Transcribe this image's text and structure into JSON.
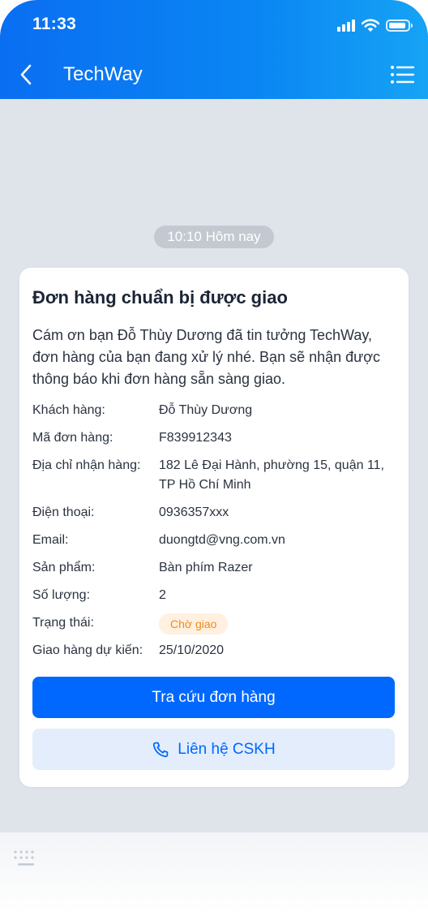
{
  "status_bar": {
    "time": "11:33",
    "icons": [
      "signal-icon",
      "wifi-icon",
      "battery-icon"
    ]
  },
  "header": {
    "title": "TechWay",
    "back_icon": "chevron-left-icon",
    "menu_icon": "list-menu-icon"
  },
  "chat": {
    "timestamp": "10:10 Hôm nay"
  },
  "order_card": {
    "title": "Đơn hàng chuẩn bị được giao",
    "message": "Cám ơn bạn Đỗ Thùy Dương đã tin tưởng TechWay, đơn hàng của bạn đang xử lý nhé. Bạn sẽ nhận được thông báo khi đơn hàng sẵn sàng giao.",
    "fields": [
      {
        "label": "Khách hàng:",
        "value": "Đỗ Thùy Dương"
      },
      {
        "label": "Mã đơn hàng:",
        "value": "F839912343"
      },
      {
        "label": "Địa chỉ nhận hàng:",
        "value": "182 Lê Đại Hành, phường 15, quận 11, TP Hồ Chí Minh"
      },
      {
        "label": "Điện thoại:",
        "value": "0936357xxx"
      },
      {
        "label": "Email:",
        "value": "duongtd@vng.com.vn"
      },
      {
        "label": "Sản phẩm:",
        "value": "Bàn phím Razer"
      },
      {
        "label": "Số lượng:",
        "value": "2"
      },
      {
        "label": "Trạng thái:",
        "value": "Chờ giao"
      },
      {
        "label": "Giao hàng dự kiến:",
        "value": "25/10/2020"
      }
    ],
    "primary_button": "Tra cứu đơn hàng",
    "secondary_button": "Liên hệ CSKH",
    "status_badge_color": "#f08a1c"
  },
  "colors": {
    "brand": "#0068ff",
    "header_gradient_start": "#0a6ef2",
    "header_gradient_end": "#16a3f5"
  }
}
